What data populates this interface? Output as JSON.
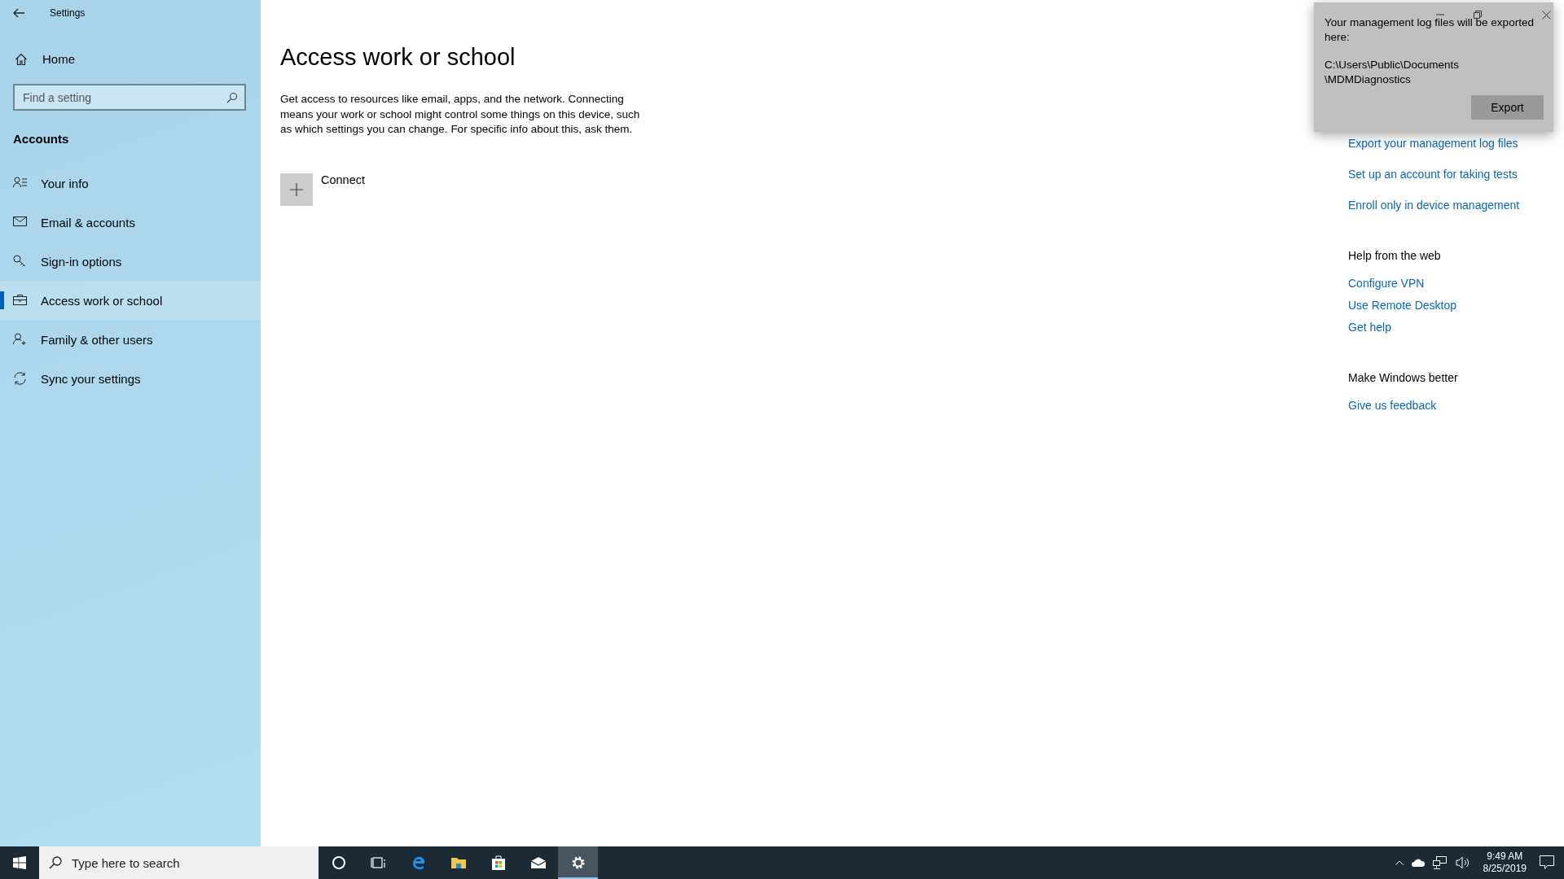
{
  "window": {
    "title": "Settings"
  },
  "sidebar": {
    "home": "Home",
    "search": {
      "placeholder": "Find a setting"
    },
    "section": "Accounts",
    "items": [
      {
        "label": "Your info",
        "selected": false
      },
      {
        "label": "Email & accounts",
        "selected": false
      },
      {
        "label": "Sign-in options",
        "selected": false
      },
      {
        "label": "Access work or school",
        "selected": true
      },
      {
        "label": "Family & other users",
        "selected": false
      },
      {
        "label": "Sync your settings",
        "selected": false
      }
    ]
  },
  "main": {
    "heading": "Access work or school",
    "description": "Get access to resources like email, apps, and the network. Connecting means your work or school might control some things on this device, such as which settings you can change. For specific info about this, ask them.",
    "connect": "Connect"
  },
  "related": {
    "links": [
      "Export your management log files",
      "Set up an account for taking tests",
      "Enroll only in device management"
    ]
  },
  "help": {
    "heading": "Help from the web",
    "links": [
      "Configure VPN",
      "Use Remote Desktop",
      "Get help"
    ]
  },
  "feedback": {
    "heading": "Make Windows better",
    "links": [
      "Give us feedback"
    ]
  },
  "dialog": {
    "message": "Your management log files will be exported here:",
    "path_lines": [
      "C:\\Users\\Public\\Documents",
      "\\MDMDiagnostics"
    ],
    "button": "Export"
  },
  "taskbar": {
    "search_placeholder": "Type here to search",
    "apps": [
      {
        "selected": false
      },
      {
        "selected": false
      },
      {
        "selected": false
      },
      {
        "selected": false
      },
      {
        "selected": false
      },
      {
        "selected": false
      },
      {
        "selected": true
      }
    ],
    "time": "9:49 AM",
    "date": "8/25/2019"
  }
}
